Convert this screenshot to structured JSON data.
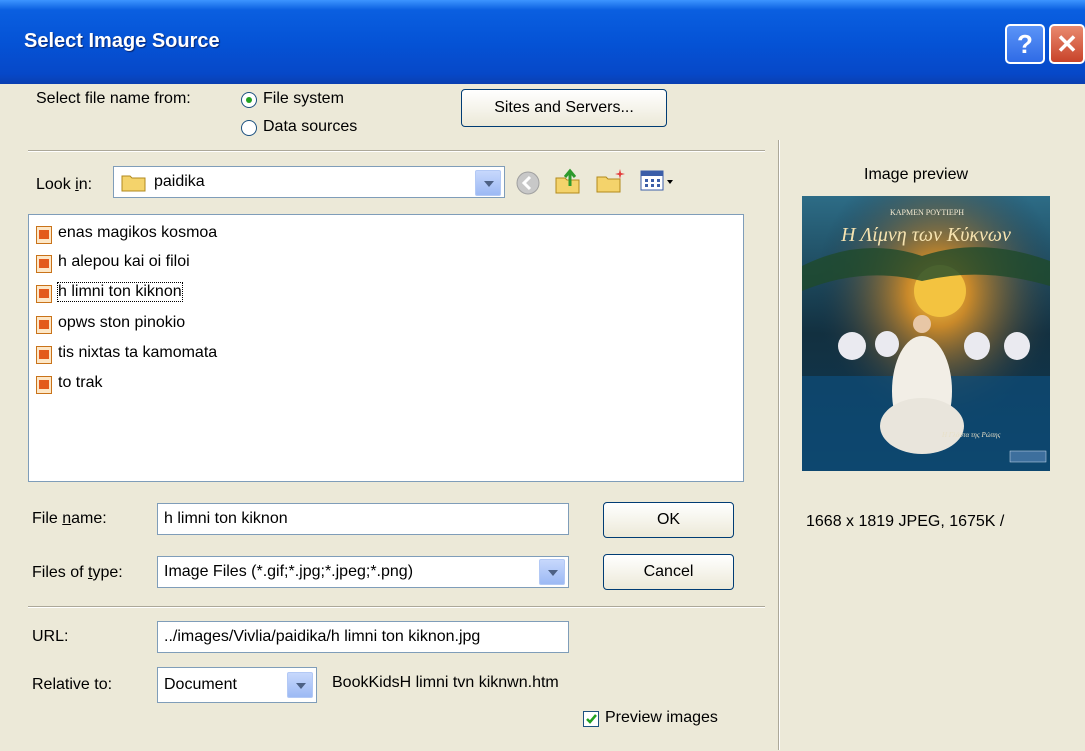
{
  "window": {
    "title": "Select Image Source",
    "help_glyph": "?",
    "close_glyph": "✕"
  },
  "source": {
    "label": "Select file name from:",
    "options": [
      {
        "label": "File system",
        "selected": true
      },
      {
        "label": "Data sources",
        "selected": false
      }
    ],
    "sites_button": "Sites and Servers..."
  },
  "look_in": {
    "label": "Look in:",
    "accel": "i",
    "value": "paidika"
  },
  "files": [
    {
      "name": "enas magikos kosmoa"
    },
    {
      "name": "h alepou kai oi filoi"
    },
    {
      "name": "h limni ton kiknon"
    },
    {
      "name": "opws ston pinokio"
    },
    {
      "name": "tis nixtas ta kamomata"
    },
    {
      "name": "to trak"
    }
  ],
  "file_name": {
    "label": "File name:",
    "value": "h limni ton kiknon"
  },
  "file_type": {
    "label": "Files of type:",
    "value": "Image Files (*.gif;*.jpg;*.jpeg;*.png)"
  },
  "buttons": {
    "ok": "OK",
    "cancel": "Cancel"
  },
  "url": {
    "label": "URL:",
    "value": "../images/Vivlia/paidika/h limni ton kiknon.jpg"
  },
  "relative": {
    "label": "Relative to:",
    "value": "Document",
    "file": "BookKidsH limni tvn kiknwn.htm"
  },
  "preview_images": {
    "label": "Preview images",
    "checked": true
  },
  "preview": {
    "heading": "Image preview",
    "info": "1668 x 1819 JPEG, 1675K /",
    "cover_author": "ΚΑΡΜΕΝ ΡΟΥΤΙΕΡΗ",
    "cover_title": "Η Λίμνη των Κύκνων",
    "cover_footer": "Η Γλάστα της Ρώπης"
  },
  "colors": {
    "titlebar": "#0553d6",
    "dialog": "#ece9d8",
    "radio_dot": "#21a121"
  }
}
